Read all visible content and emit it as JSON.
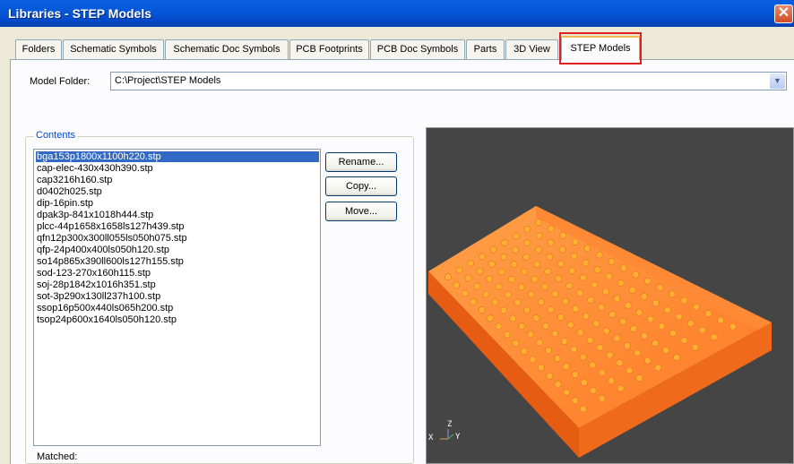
{
  "window": {
    "title": "Libraries - STEP Models",
    "close_icon": "close-icon"
  },
  "tabs": [
    {
      "label": "Folders",
      "active": false
    },
    {
      "label": "Schematic Symbols",
      "active": false
    },
    {
      "label": "Schematic Doc Symbols",
      "active": false
    },
    {
      "label": "PCB Footprints",
      "active": false
    },
    {
      "label": "PCB Doc Symbols",
      "active": false
    },
    {
      "label": "Parts",
      "active": false
    },
    {
      "label": "3D View",
      "active": false
    },
    {
      "label": "STEP Models",
      "active": true
    }
  ],
  "model_folder": {
    "label": "Model Folder:",
    "value": "C:\\Project\\STEP Models"
  },
  "contents": {
    "legend": "Contents",
    "items": [
      "bga153p1800x1100h220.stp",
      "cap-elec-430x430h390.stp",
      "cap3216h160.stp",
      "d0402h025.stp",
      "dip-16pin.stp",
      "dpak3p-841x1018h444.stp",
      "plcc-44p1658x1658ls127h439.stp",
      "qfn12p300x300ll055ls050h075.stp",
      "qfp-24p400x400ls050h120.stp",
      "so14p865x390ll600ls127h155.stp",
      "sod-123-270x160h115.stp",
      "soj-28p1842x1016h351.stp",
      "sot-3p290x130ll237h100.stp",
      "ssop16p500x440ls065h200.stp",
      "tsop24p600x1640ls050h120.stp"
    ],
    "selected_index": 0
  },
  "buttons": {
    "rename": "Rename...",
    "copy": "Copy...",
    "move": "Move..."
  },
  "matched_label": "Matched:",
  "viewer": {
    "axis_x": "X",
    "axis_y": "Y",
    "axis_z": "Z",
    "background": "#454545",
    "body_color": "#ff7a26",
    "ball_color": "#ffb030"
  },
  "colors": {
    "titlebar": "#0558d8",
    "selection": "#316ac5",
    "highlight": "#e02020"
  }
}
